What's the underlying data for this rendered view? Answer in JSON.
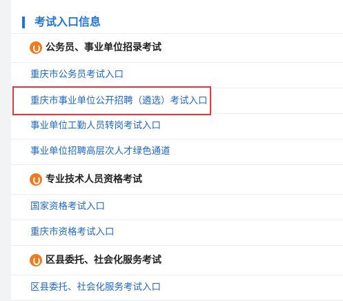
{
  "header": {
    "title": "考试入口信息"
  },
  "sections": [
    {
      "title": "公务员、事业单位招录考试",
      "links": [
        "重庆市公务员考试入口",
        "重庆市事业单位公开招聘（遴选）考试入口",
        "事业单位工勤人员转岗考试入口",
        "事业单位招聘高层次人才绿色通道"
      ]
    },
    {
      "title": "专业技术人员资格考试",
      "links": [
        "国家资格考试入口",
        "重庆市资格考试入口"
      ]
    },
    {
      "title": "区县委托、社会化服务考试",
      "links": [
        "区县委托、社会化服务考试入口"
      ]
    }
  ],
  "highlight_color": "#e03a3a",
  "accent_color": "#1f74d8",
  "icon_color": "#f07a1e"
}
